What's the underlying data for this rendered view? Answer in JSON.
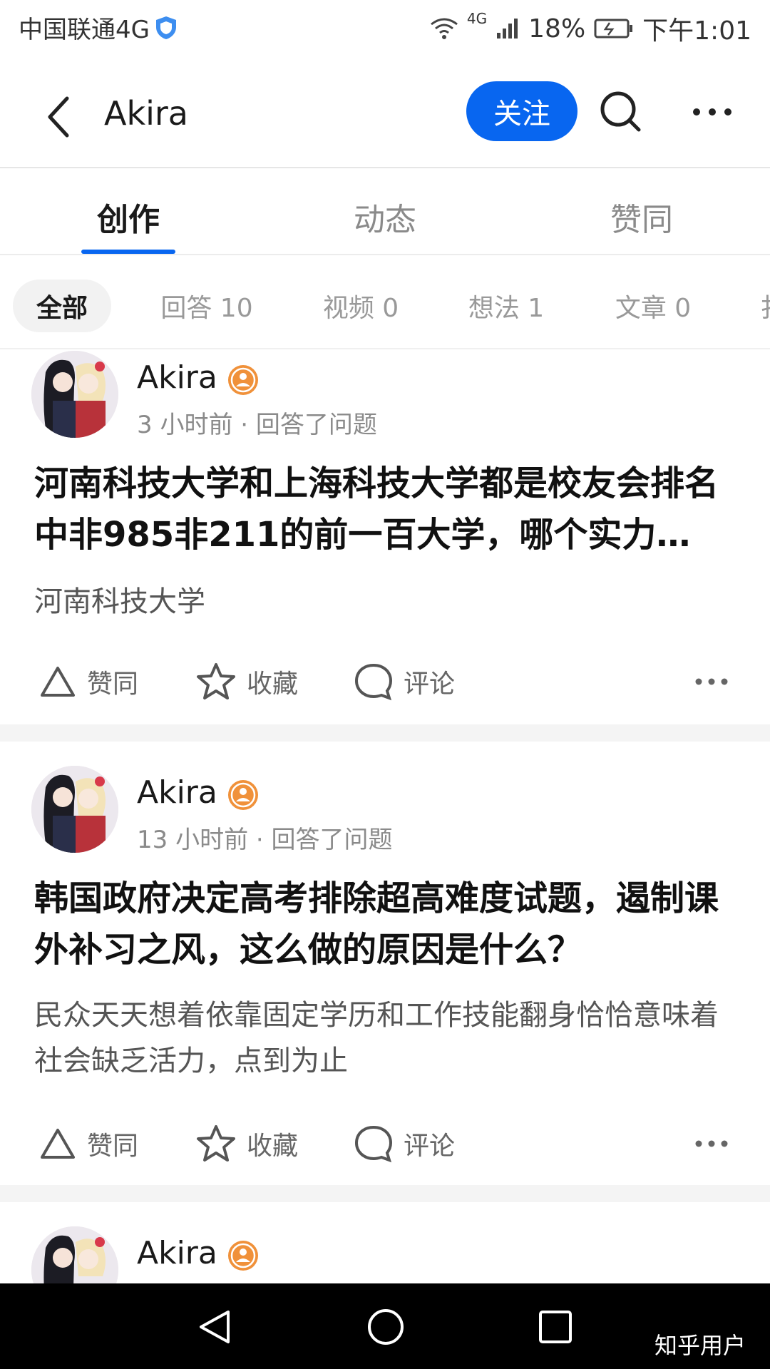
{
  "status_bar": {
    "carrier": "中国联通4G",
    "network": "4G",
    "battery": "18%",
    "time": "下午1:01"
  },
  "header": {
    "title": "Akira",
    "follow_label": "关注"
  },
  "tabs": [
    {
      "label": "创作",
      "active": true
    },
    {
      "label": "动态",
      "active": false
    },
    {
      "label": "赞同",
      "active": false
    }
  ],
  "filters": [
    {
      "label": "全部",
      "active": true
    },
    {
      "label": "回答 10",
      "active": false
    },
    {
      "label": "视频 0",
      "active": false
    },
    {
      "label": "想法 1",
      "active": false
    },
    {
      "label": "文章 0",
      "active": false
    }
  ],
  "feed": [
    {
      "author": "Akira",
      "meta": "3 小时前 · 回答了问题",
      "title": "河南科技大学和上海科技大学都是校友会排名中非985非211的前一百大学，哪个实力…",
      "excerpt": "河南科技大学",
      "actions": {
        "upvote": "赞同",
        "collect": "收藏",
        "comment": "评论"
      }
    },
    {
      "author": "Akira",
      "meta": "13 小时前 · 回答了问题",
      "title": "韩国政府决定高考排除超高难度试题，遏制课外补习之风，这么做的原因是什么？",
      "excerpt": "民众天天想着依靠固定学历和工作技能翻身恰恰意味着社会缺乏活力，点到为止",
      "actions": {
        "upvote": "赞同",
        "collect": "收藏",
        "comment": "评论"
      }
    },
    {
      "author": "Akira"
    }
  ],
  "watermark": "知乎用户",
  "colors": {
    "accent": "#0866f0",
    "badge": "#f0913a",
    "separator": "#f4f4f4"
  }
}
